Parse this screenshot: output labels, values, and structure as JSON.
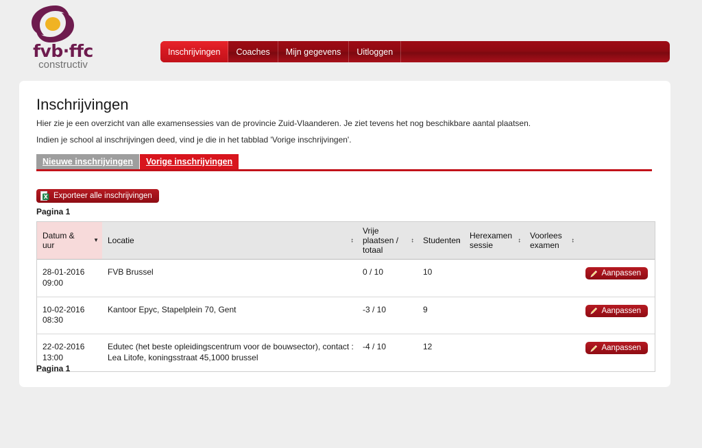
{
  "brand": {
    "logo_text": "fvb·ffc",
    "logo_sub": "constructiv",
    "logo_icon": "swirl-logo",
    "purple": "#6e1b4e",
    "amber": "#f0b323"
  },
  "nav": {
    "items": [
      {
        "label": "Inschrijvingen",
        "active": true
      },
      {
        "label": "Coaches",
        "active": false
      },
      {
        "label": "Mijn gegevens",
        "active": false
      },
      {
        "label": "Uitloggen",
        "active": false
      }
    ],
    "bar_color": "#8f0a12",
    "active_color": "#d41820"
  },
  "page": {
    "title": "Inschrijvingen",
    "intro_line1": "Hier zie je een overzicht van alle examensessies van de provincie Zuid-Vlaanderen. Je ziet tevens het nog beschikbare aantal plaatsen.",
    "intro_line2": "Indien je school al inschrijvingen deed, vind je die in het tabblad 'Vorige inschrijvingen'."
  },
  "tabs": [
    {
      "label": "Nieuwe inschrijvingen",
      "active": false
    },
    {
      "label": "Vorige inschrijvingen",
      "active": true
    }
  ],
  "toolbar": {
    "export_label": "Exporteer alle inschrijvingen",
    "export_icon": "excel-icon"
  },
  "pagination": {
    "top_label": "Pagina 1",
    "bottom_label": "Pagina 1"
  },
  "table": {
    "columns": [
      {
        "label": "Datum &\nuur",
        "sorted": true,
        "sort_icon": "chevron-down-icon"
      },
      {
        "label": "Locatie",
        "sorted": false,
        "sort_icon": "sort-updown-icon"
      },
      {
        "label": "Vrije\nplaatsen /\ntotaal",
        "sorted": false,
        "sort_icon": "sort-updown-icon"
      },
      {
        "label": "Studenten",
        "sorted": false,
        "sort_icon": "sort-updown-icon"
      },
      {
        "label": "Herexamen\nsessie",
        "sorted": false,
        "sort_icon": "sort-updown-icon"
      },
      {
        "label": "Voorlees\nexamen",
        "sorted": false,
        "sort_icon": "sort-updown-icon"
      },
      {
        "label": "",
        "sorted": false,
        "sort_icon": ""
      }
    ],
    "rows": [
      {
        "datum": "28-01-2016\n09:00",
        "locatie": "FVB Brussel",
        "vrije_plaatsen": "0 / 10",
        "studenten": "10",
        "herexamen": "",
        "voorlees": "",
        "action_label": "Aanpassen",
        "action_icon": "pencil-icon"
      },
      {
        "datum": "10-02-2016\n08:30",
        "locatie": "Kantoor Epyc, Stapelplein 70, Gent",
        "vrije_plaatsen": "-3 / 10",
        "studenten": "9",
        "herexamen": "",
        "voorlees": "",
        "action_label": "Aanpassen",
        "action_icon": "pencil-icon"
      },
      {
        "datum": "22-02-2016\n13:00",
        "locatie": "Edutec (het beste opleidingscentrum voor de bouwsector), contact : Lea Litofe, koningsstraat 45,1000 brussel",
        "vrije_plaatsen": "-4 / 10",
        "studenten": "12",
        "herexamen": "",
        "voorlees": "",
        "action_label": "Aanpassen",
        "action_icon": "pencil-icon"
      }
    ]
  }
}
